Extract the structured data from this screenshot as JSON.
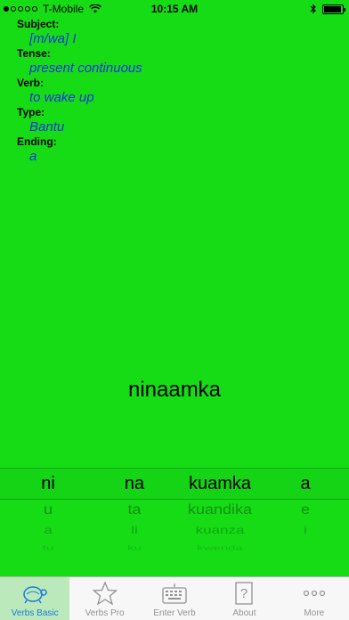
{
  "status_bar": {
    "carrier": "T-Mobile",
    "time": "10:15 AM",
    "signal_dots_filled": 1,
    "signal_dots_total": 5,
    "battery_level": 0.95
  },
  "info": {
    "rows": [
      {
        "label": "Subject:",
        "value": "[m/wa] I"
      },
      {
        "label": "Tense:",
        "value": "present continuous"
      },
      {
        "label": "Verb:",
        "value": "to wake up"
      },
      {
        "label": "Type:",
        "value": "Bantu"
      },
      {
        "label": "Ending:",
        "value": "a"
      }
    ]
  },
  "result_word": "ninaamka",
  "picker": {
    "columns": [
      {
        "selected": "ni",
        "below": [
          "u",
          "a",
          "tu"
        ]
      },
      {
        "selected": "na",
        "below": [
          "ta",
          "li",
          "ku"
        ]
      },
      {
        "selected": "kuamka",
        "below": [
          "kuandika",
          "kuanza",
          "kwenda"
        ]
      },
      {
        "selected": "a",
        "below": [
          "e",
          "i",
          ""
        ]
      }
    ]
  },
  "tabs": [
    {
      "label": "Verbs Basic",
      "icon": "turtle-icon",
      "active": true
    },
    {
      "label": "Verbs Pro",
      "icon": "star-icon",
      "active": false
    },
    {
      "label": "Enter Verb",
      "icon": "keyboard-icon",
      "active": false
    },
    {
      "label": "About",
      "icon": "question-book-icon",
      "active": false
    },
    {
      "label": "More",
      "icon": "more-dots-icon",
      "active": false
    }
  ],
  "colors": {
    "background": "#16dc16",
    "value_text": "#1a33e0",
    "tab_active_bg": "#bce9bc",
    "tab_active_label": "#1a7bd8",
    "tab_inactive_label": "#929292"
  }
}
